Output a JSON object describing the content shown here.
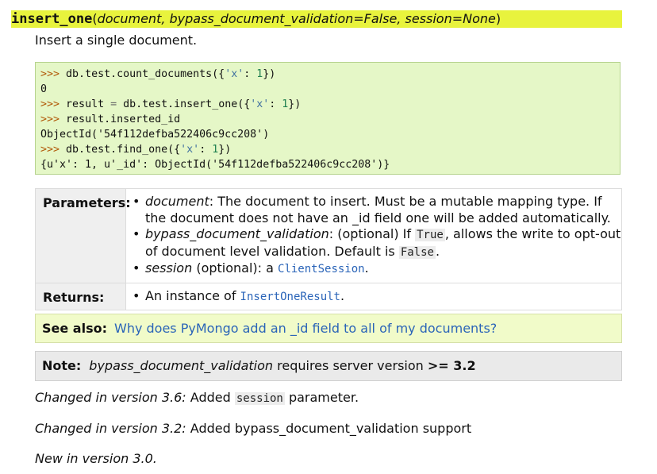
{
  "signature": {
    "name": "insert_one",
    "params": "document, bypass_document_validation=False, session=None"
  },
  "summary": "Insert a single document.",
  "code_example": [
    [
      "db.test.count_documents({",
      "'x'",
      ": ",
      "1",
      "})"
    ],
    "0",
    [
      "result ",
      "=",
      " db.test.insert_one({",
      "'x'",
      ": ",
      "1",
      "})"
    ],
    [
      "result.inserted_id"
    ],
    "ObjectId('54f112defba522406c9cc208')",
    [
      "db.test.find_one({",
      "'x'",
      ": ",
      "1",
      "})"
    ],
    "{u'x': 1, u'_id': ObjectId('54f112defba522406c9cc208')}"
  ],
  "code_prompt": ">>>",
  "parameters": {
    "label": "Parameters:",
    "items": [
      {
        "name": "document",
        "sep": ": ",
        "text": "The document to insert. Must be a mutable mapping type. If the document does not have an _id field one will be added automatically."
      },
      {
        "name": "bypass_document_validation",
        "sep": ": ",
        "text_a": "(optional) If ",
        "code_a": "True",
        "text_b": ", allows the write to opt-out of document level validation. Default is ",
        "code_b": "False",
        "text_c": "."
      },
      {
        "name": "session",
        "text_a": " (optional): a ",
        "link": "ClientSession",
        "text_c": "."
      }
    ]
  },
  "returns": {
    "label": "Returns:",
    "text_a": "An instance of ",
    "link": "InsertOneResult",
    "text_c": "."
  },
  "see_also": {
    "label": "See also:",
    "link": "Why does PyMongo add an _id field to all of my documents?"
  },
  "note": {
    "label": "Note:",
    "param": "bypass_document_validation",
    "text": " requires server version ",
    "requirement": ">= 3.2"
  },
  "versions": [
    {
      "label": "Changed in version 3.6:",
      "text_a": " Added ",
      "code": "session",
      "text_b": " parameter."
    },
    {
      "label": "Changed in version 3.2:",
      "text_a": " Added bypass_document_validation support"
    },
    {
      "label": "New in version 3.0."
    }
  ],
  "colors": {
    "signature_bg": "#e8f33d",
    "code_bg": "#e5f7c7",
    "link": "#2a64b8",
    "see_also_bg": "#f1fbc9",
    "note_bg": "#eaeaea"
  }
}
